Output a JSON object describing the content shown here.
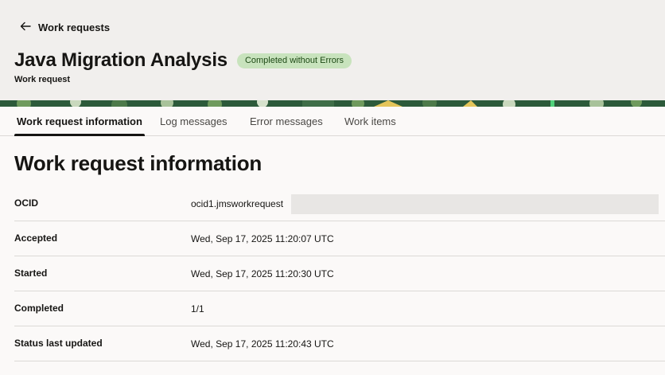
{
  "header": {
    "back_label": "Work requests",
    "title": "Java Migration Analysis",
    "status_badge": "Completed without Errors",
    "subtitle": "Work request"
  },
  "tabs": [
    {
      "label": "Work request information",
      "active": true
    },
    {
      "label": "Log messages",
      "active": false
    },
    {
      "label": "Error messages",
      "active": false
    },
    {
      "label": "Work items",
      "active": false
    }
  ],
  "section": {
    "title": "Work request information"
  },
  "details": [
    {
      "label": "OCID",
      "value": "ocid1.jmsworkrequest"
    },
    {
      "label": "Accepted",
      "value": "Wed, Sep 17, 2025 11:20:07 UTC"
    },
    {
      "label": "Started",
      "value": "Wed, Sep 17, 2025 11:20:30 UTC"
    },
    {
      "label": "Completed",
      "value": "1/1"
    },
    {
      "label": "Status last updated",
      "value": "Wed, Sep 17, 2025 11:20:43 UTC"
    }
  ],
  "colors": {
    "badge_bg": "#c8e3bd",
    "badge_text": "#1e4a16",
    "banner": "#2c5a3a"
  }
}
